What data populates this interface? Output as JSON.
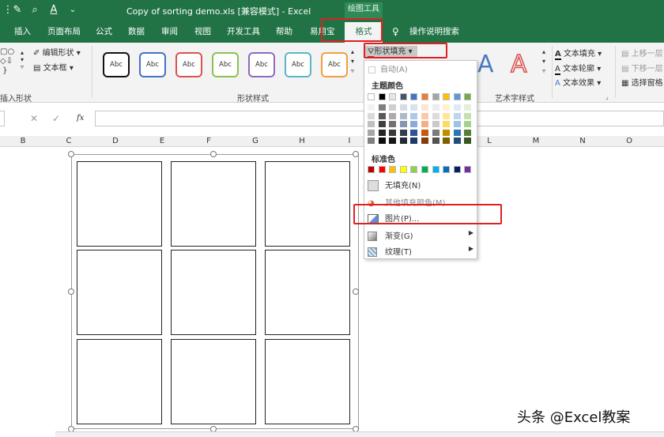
{
  "window": {
    "title": "Copy of sorting demo.xls [兼容模式] - Excel",
    "context_label": "绘图工具"
  },
  "tabs": [
    "插入",
    "页面布局",
    "公式",
    "数据",
    "审阅",
    "视图",
    "开发工具",
    "帮助",
    "易用宝"
  ],
  "active_tab": "格式",
  "tell_me": "操作说明搜索",
  "ribbon": {
    "insert_shapes": {
      "edit_shape": "编辑形状",
      "text_box": "文本框",
      "label": "插入形状"
    },
    "shape_styles": {
      "sample": "Abc",
      "fill_button": "形状填充",
      "label": "形状样式"
    },
    "wordart": {
      "label": "艺术字样式",
      "sample": "A",
      "text_fill": "文本填充",
      "text_outline": "文本轮廓",
      "text_effects": "文本效果"
    },
    "arrange": {
      "bring_forward": "上移一层",
      "send_backward": "下移一层",
      "selection_pane": "选择窗格"
    }
  },
  "formula_bar": {
    "fx": "fx"
  },
  "columns": [
    "B",
    "C",
    "D",
    "E",
    "F",
    "G",
    "H",
    "I",
    "",
    "",
    "",
    "L",
    "M",
    "N",
    "O"
  ],
  "fill_menu": {
    "auto": "自动(A)",
    "theme_colors_label": "主题颜色",
    "standard_colors_label": "标准色",
    "no_fill": "无填充(N)",
    "more_colors": "其他填充颜色(M)...",
    "picture": "图片(P)...",
    "gradient": "渐变(G)",
    "texture": "纹理(T)"
  },
  "colors": {
    "theme_top": [
      "#ffffff",
      "#000000",
      "#e7e6e6",
      "#44546a",
      "#4472c4",
      "#ed7d31",
      "#a5a5a5",
      "#ffc000",
      "#5b9bd5",
      "#70ad47"
    ],
    "theme_cols": [
      [
        "#f2f2f2",
        "#d9d9d9",
        "#bfbfbf",
        "#a6a6a6",
        "#7f7f7f"
      ],
      [
        "#7f7f7f",
        "#595959",
        "#404040",
        "#262626",
        "#0d0d0d"
      ],
      [
        "#d0cece",
        "#aeaaaa",
        "#757171",
        "#3a3838",
        "#171616"
      ],
      [
        "#d6dce4",
        "#adb9ca",
        "#8496b0",
        "#333f4f",
        "#222a35"
      ],
      [
        "#d9e2f3",
        "#b4c6e7",
        "#8eaadb",
        "#2f5496",
        "#1f3864"
      ],
      [
        "#fbe5d5",
        "#f7caac",
        "#f4b083",
        "#c55a11",
        "#833c0b"
      ],
      [
        "#ededed",
        "#dbdbdb",
        "#c9c9c9",
        "#7b7b7b",
        "#525252"
      ],
      [
        "#fff2cc",
        "#fee599",
        "#ffd965",
        "#bf8f00",
        "#7f6000"
      ],
      [
        "#deeaf6",
        "#bdd7ee",
        "#9cc2e5",
        "#2e75b5",
        "#1f4e79"
      ],
      [
        "#e2efd9",
        "#c5e0b3",
        "#a8d08d",
        "#538135",
        "#375623"
      ]
    ],
    "standard": [
      "#c00000",
      "#ff0000",
      "#ffc000",
      "#ffff00",
      "#92d050",
      "#00b050",
      "#00b0f0",
      "#0070c0",
      "#002060",
      "#7030a0"
    ],
    "style_borders": [
      "#111111",
      "#4472c4",
      "#d9534f",
      "#8cc152",
      "#8e6bbd",
      "#5bb5c9",
      "#f0a040"
    ]
  },
  "watermark": "头条 @Excel教案"
}
